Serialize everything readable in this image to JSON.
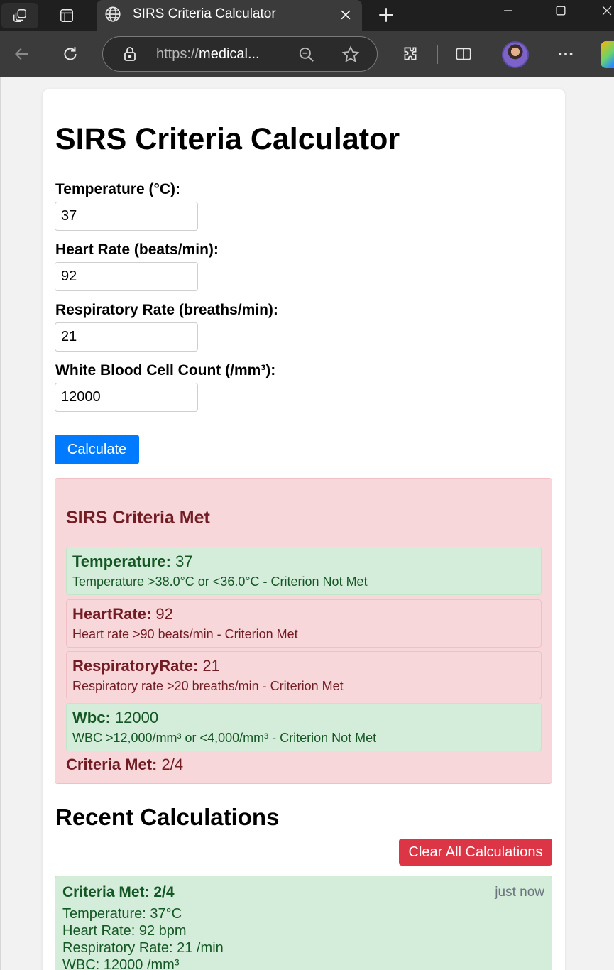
{
  "browser": {
    "tab_title": "SIRS Criteria Calculator",
    "url_prefix": "https://",
    "url_host": "medical..."
  },
  "page": {
    "title": "SIRS Criteria Calculator",
    "form": {
      "temperature": {
        "label": "Temperature (°C):",
        "value": "37"
      },
      "heart_rate": {
        "label": "Heart Rate (beats/min):",
        "value": "92"
      },
      "respiratory_rate": {
        "label": "Respiratory Rate (breaths/min):",
        "value": "21"
      },
      "wbc": {
        "label": "White Blood Cell Count (/mm³):",
        "value": "12000"
      },
      "calculate_label": "Calculate"
    },
    "result": {
      "title": "SIRS Criteria Met",
      "criteria": [
        {
          "name": "Temperature:",
          "value": "37",
          "description": "Temperature >38.0°C or <36.0°C - Criterion Not Met",
          "met": false
        },
        {
          "name": "HeartRate:",
          "value": "92",
          "description": "Heart rate >90 beats/min - Criterion Met",
          "met": true
        },
        {
          "name": "RespiratoryRate:",
          "value": "21",
          "description": "Respiratory rate >20 breaths/min - Criterion Met",
          "met": true
        },
        {
          "name": "Wbc:",
          "value": "12000",
          "description": "WBC >12,000/mm³ or <4,000/mm³ - Criterion Not Met",
          "met": false
        }
      ],
      "summary_label": "Criteria Met:",
      "summary_value": "2/4"
    },
    "recent": {
      "title": "Recent Calculations",
      "clear_label": "Clear All Calculations",
      "items": [
        {
          "title": "Criteria Met: 2/4",
          "time": "just now",
          "lines": [
            "Temperature: 37°C",
            "Heart Rate: 92 bpm",
            "Respiratory Rate: 21 /min",
            "WBC: 12000 /mm³"
          ]
        }
      ]
    }
  },
  "colors": {
    "primary": "#007bff",
    "danger": "#dc3545",
    "met_bg": "#f8d7da",
    "met_text": "#721c24",
    "notmet_bg": "#d4edda",
    "notmet_text": "#155724"
  }
}
